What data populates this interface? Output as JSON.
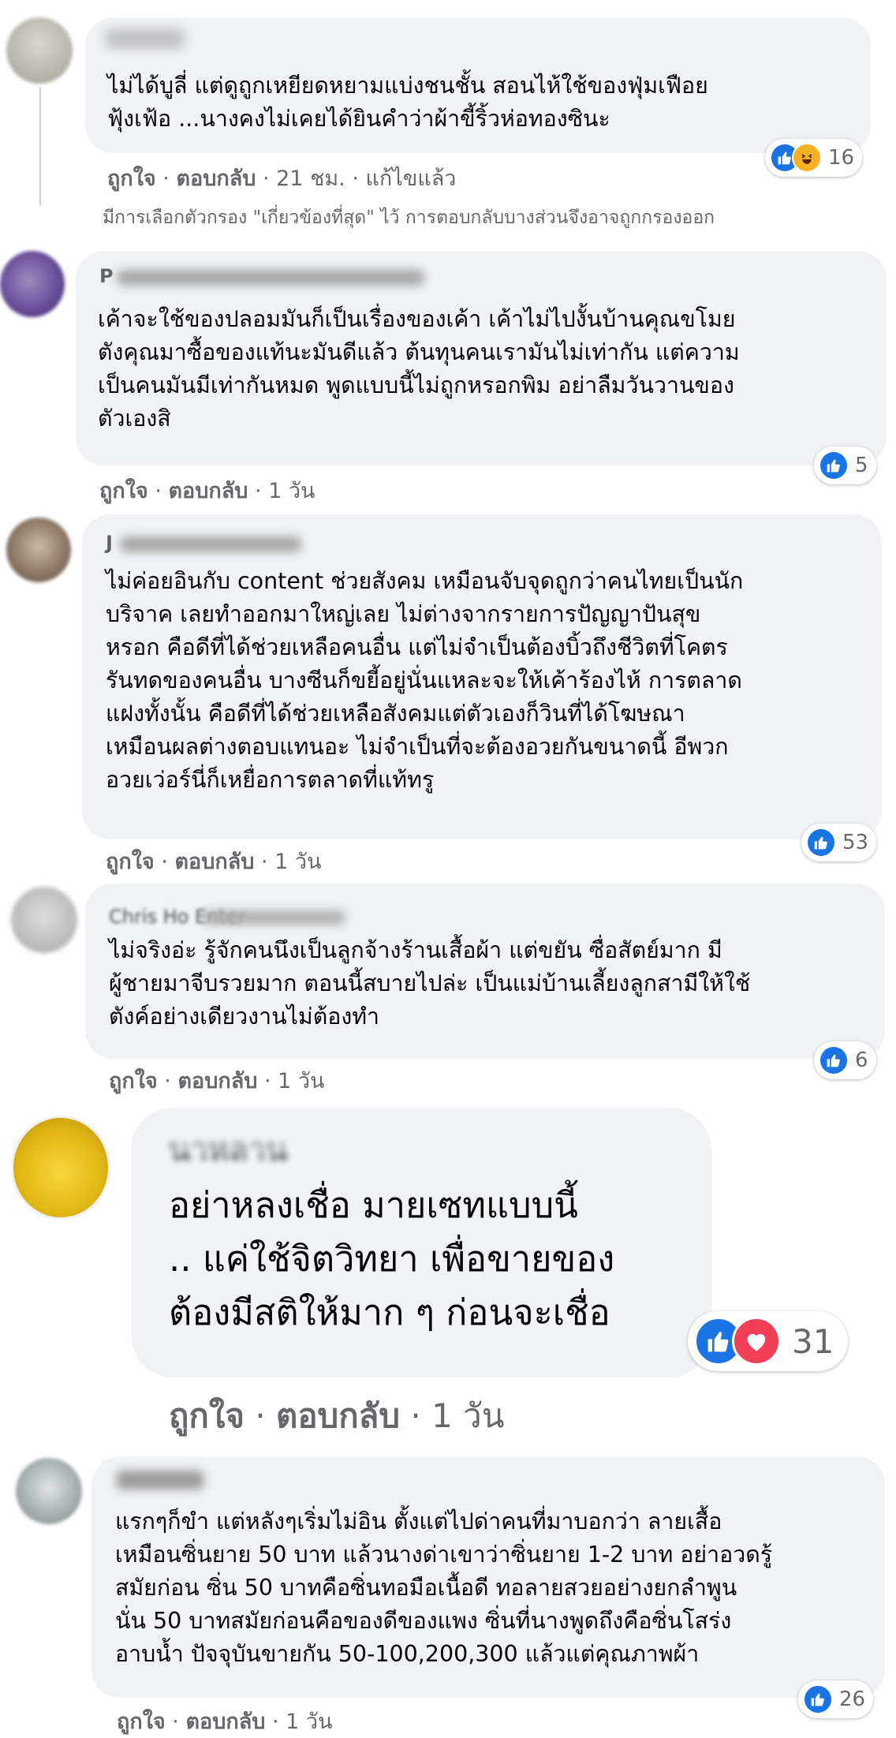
{
  "colors": {
    "bubble": "#f0f2f5",
    "meta": "#65676b",
    "like": "#1b74e4",
    "love": "#f33e58",
    "haha": "#f7b125"
  },
  "filter_note": "มีการเลือกตัวกรอง \"เกี่ยวข้องที่สุด\" ไว้ การตอบกลับบางส่วนจึงอาจถูกกรองออก",
  "comments": [
    {
      "author": "",
      "lines": [
        "ไม่ได้บูลี่ แต่ดูถูกเหยียดหยามแบ่งชนชั้น สอนไห้ใช้ของฟุ่มเฟือย",
        "ฟุ้งเฟ้อ ...นางคงไม่เคยได้ยินคำว่าผ้าขี้ริ้วห่อทองซินะ"
      ],
      "like": "ถูกใจ",
      "reply": "ตอบกลับ",
      "time": "21 ชม.",
      "edited": "แก้ไขแล้ว",
      "reactions": [
        "like-icon",
        "haha-icon"
      ],
      "count": "16"
    },
    {
      "author": "P",
      "lines": [
        "เค้าจะใช้ของปลอมมันก็เป็นเรื่องของเค้า เค้าไม่ไปงั้นบ้านคุณขโมย",
        "ตังคุณมาซื้อของแท้นะมันดีแล้ว ต้นทุนคนเรามันไม่เท่ากัน แต่ความ",
        "เป็นคนมันมีเท่ากันหมด พูดแบบนี้ไม่ถูกหรอกพิม อย่าลืมวันวานของ",
        "ตัวเองสิ"
      ],
      "like": "ถูกใจ",
      "reply": "ตอบกลับ",
      "time": "1 วัน",
      "reactions": [
        "like-icon"
      ],
      "count": "5"
    },
    {
      "author": "J",
      "lines": [
        "ไม่ค่อยอินกับ content ช่วยสังคม เหมือนจับจุดถูกว่าคนไทยเป็นนัก",
        "บริจาค เลยทำออกมาใหญ่เลย ไม่ต่างจากรายการปัญญาปันสุข",
        "หรอก คือดีที่ได้ช่วยเหลือคนอื่น แต่ไม่จำเป็นต้องบิ้วถึงชีวิตที่โคตร",
        "รันทดของคนอื่น บางซีนก็ขยี้อยู่นั่นแหละจะให้เค้าร้องไห้ การตลาด",
        "แฝงทั้งนั้น คือดีที่ได้ช่วยเหลือสังคมแต่ตัวเองก็วินที่ได้โฆษณา",
        "เหมือนผลต่างตอบแทนอะ ไม่จำเป็นที่จะต้องอวยกันขนาดนี้ อีพวก",
        "อวยเว่อร์นี่ก็เหยื่อการตลาดที่แท้ทรู"
      ],
      "like": "ถูกใจ",
      "reply": "ตอบกลับ",
      "time": "1 วัน",
      "reactions": [
        "like-icon"
      ],
      "count": "53"
    },
    {
      "author": "Chris Ho Enter",
      "lines": [
        "ไม่จริงอ่ะ รู้จักคนนึงเป็นลูกจ้างร้านเสื้อผ้า แต่ขยัน ซื่อสัตย์มาก มี",
        "ผู้ชายมาจีบรวยมาก ตอนนี้สบายไปล่ะ เป็นแม่บ้านเลี้ยงลูกสามีให้ใช้",
        "ตังค์อย่างเดียวงานไม่ต้องทำ"
      ],
      "like": "ถูกใจ",
      "reply": "ตอบกลับ",
      "time": "1 วัน",
      "reactions": [
        "like-icon"
      ],
      "count": "6"
    },
    {
      "author": "นาหลาน",
      "lines": [
        "อย่าหลงเชื่อ มายเซทแบบนี้",
        ".. แค่ใช้จิตวิทยา เพื่อขายของ",
        "ต้องมีสติให้มาก ๆ ก่อนจะเชื่อ"
      ],
      "like": "ถูกใจ",
      "reply": "ตอบกลับ",
      "time": "1 วัน",
      "reactions": [
        "like-icon",
        "love-icon"
      ],
      "count": "31"
    },
    {
      "author": "",
      "lines": [
        "แรกๆก็ขำ แต่หลังๆเริ่มไม่อิน ตั้งแต่ไปด่าคนที่มาบอกว่า ลายเสื้อ",
        "เหมือนซิ่นยาย 50 บาท แล้วนางด่าเขาว่าซิ่นยาย 1-2 บาท อย่าอวดรู้",
        "สมัยก่อน ซิ่น 50 บาทคือซิ่นทอมือเนื้อดี ทอลายสวยอย่างยกลำพูน",
        "นั่น 50 บาทสมัยก่อนคือของดีของแพง ซิ่นที่นางพูดถึงคือซิ่นโสร่ง",
        "อาบน้ำ ปัจจุบันขายกัน 50-100,200,300 แล้วแต่คุณภาพผ้า"
      ],
      "like": "ถูกใจ",
      "reply": "ตอบกลับ",
      "time": "1 วัน",
      "reactions": [
        "like-icon"
      ],
      "count": "26"
    }
  ]
}
